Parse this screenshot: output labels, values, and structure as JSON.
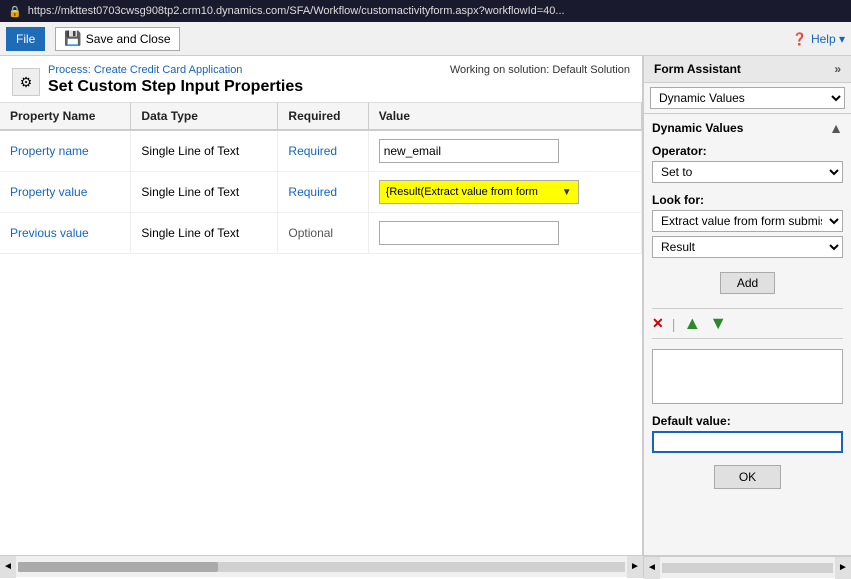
{
  "titlebar": {
    "lock_icon": "🔒",
    "url": "https://mkttest0703cwsg908tp2.crm10.dynamics.com/SFA/Workflow/customactivityform.aspx?workflowId=40..."
  },
  "toolbar": {
    "file_label": "File",
    "save_label": "Save and Close",
    "help_label": "Help ▾"
  },
  "page": {
    "process_label": "Process: Create Credit Card Application",
    "title": "Set Custom Step Input Properties",
    "working_on": "Working on solution: Default Solution"
  },
  "table": {
    "headers": [
      "Property Name",
      "Data Type",
      "Required",
      "Value"
    ],
    "rows": [
      {
        "name": "Property name",
        "data_type": "Single Line of Text",
        "required": "Required",
        "value": "new_email",
        "value_type": "text"
      },
      {
        "name": "Property value",
        "data_type": "Single Line of Text",
        "required": "Required",
        "value": "{Result(Extract value from form",
        "value_type": "dynamic"
      },
      {
        "name": "Previous value",
        "data_type": "Single Line of Text",
        "required": "Optional",
        "value": "",
        "value_type": "empty"
      }
    ]
  },
  "form_assistant": {
    "title": "Form Assistant",
    "chevron": "»",
    "dropdown_value": "Dynamic Values",
    "section_title": "Dynamic Values",
    "collapse_icon": "▲",
    "operator_label": "Operator:",
    "operator_value": "Set to",
    "lookfor_label": "Look for:",
    "lookfor_value": "Extract value from form submission",
    "result_value": "Result",
    "add_button": "Add",
    "delete_icon": "✕",
    "up_icon": "▲",
    "down_icon": "▼",
    "default_value_label": "Default value:",
    "default_value": "",
    "ok_button": "OK"
  },
  "scrollbar": {
    "left_arrow": "◄",
    "right_arrow": "►"
  }
}
